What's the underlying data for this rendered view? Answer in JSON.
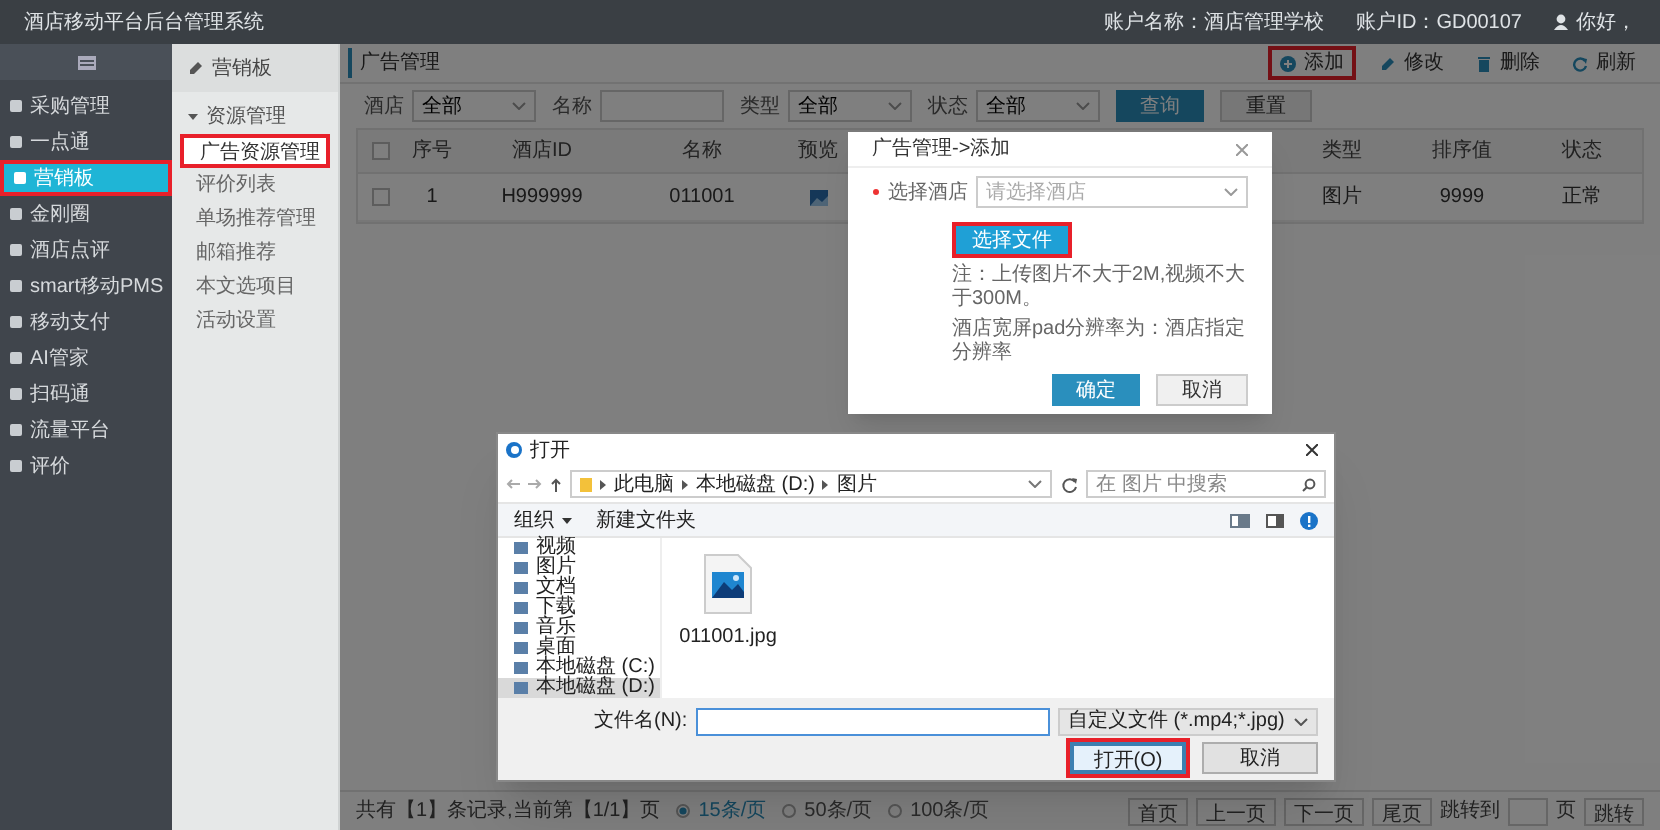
{
  "app": {
    "title": "酒店移动平台后台管理系统",
    "account_name": "账户名称：酒店管理学校",
    "account_id": "账户ID：GD00107",
    "user": "你好，"
  },
  "nav": [
    {
      "label": "采购管理",
      "selected": false,
      "highlighted": false
    },
    {
      "label": "一点通",
      "selected": false,
      "highlighted": false
    },
    {
      "label": "营销板",
      "selected": true,
      "highlighted": true
    },
    {
      "label": "金刚圈",
      "selected": false,
      "highlighted": false
    },
    {
      "label": "酒店点评",
      "selected": false,
      "highlighted": false
    },
    {
      "label": "smart移动PMS",
      "selected": false,
      "highlighted": false
    },
    {
      "label": "移动支付",
      "selected": false,
      "highlighted": false
    },
    {
      "label": "AI管家",
      "selected": false,
      "highlighted": false
    },
    {
      "label": "扫码通",
      "selected": false,
      "highlighted": false
    },
    {
      "label": "流量平台",
      "selected": false,
      "highlighted": false
    },
    {
      "label": "评价",
      "selected": false,
      "highlighted": false
    }
  ],
  "subnav": {
    "title": "营销板",
    "groups": [
      {
        "label": "资源管理",
        "expanded": true,
        "children": [
          {
            "label": "广告资源管理",
            "selected": true,
            "highlighted": true
          },
          {
            "label": "评价列表",
            "selected": false,
            "highlighted": false
          },
          {
            "label": "单场推荐管理",
            "selected": false,
            "highlighted": false
          },
          {
            "label": "邮箱推荐",
            "selected": false,
            "highlighted": false
          },
          {
            "label": "本文选项目",
            "selected": false,
            "highlighted": false
          },
          {
            "label": "活动设置",
            "selected": false,
            "highlighted": false
          }
        ]
      }
    ]
  },
  "page": {
    "breadcrumb": "广告管理",
    "toolbar": [
      {
        "label": "添加",
        "kind": "add",
        "highlighted": true
      },
      {
        "label": "修改",
        "kind": "edit",
        "highlighted": false
      },
      {
        "label": "删除",
        "kind": "delete",
        "highlighted": false
      },
      {
        "label": "刷新",
        "kind": "refresh",
        "highlighted": false
      }
    ],
    "filters": [
      {
        "label": "酒店",
        "kind": "select",
        "value": "全部"
      },
      {
        "label": "名称",
        "kind": "text"
      },
      {
        "label": "类型",
        "kind": "select",
        "value": "全部"
      },
      {
        "label": "状态",
        "kind": "select",
        "value": "全部"
      }
    ],
    "actions": [
      {
        "label": "查询",
        "kind": "primary"
      },
      {
        "label": "重置",
        "kind": "default"
      }
    ],
    "table": {
      "header_checked": false,
      "columns": [
        "序号",
        "酒店ID",
        "名称",
        "预览",
        "类型",
        "排序值",
        "状态"
      ],
      "rows": [
        {
          "checked": false,
          "number": "1",
          "hotel_id": "H999999",
          "name": "011001",
          "preview": {
            "kind": "image"
          },
          "type": "图片",
          "sort": "9999",
          "status": "正常"
        }
      ]
    },
    "pagination": {
      "summary": "共有【1】条记录,当前第【1/1】页",
      "sizes": [
        {
          "label": "15条/页",
          "selected": true
        },
        {
          "label": "50条/页",
          "selected": false
        },
        {
          "label": "100条/页",
          "selected": false
        }
      ],
      "buttons": [
        "首页",
        "上一页",
        "下一页",
        "尾页"
      ],
      "jump_label": "跳转到",
      "page_unit": "页",
      "jump_button": "跳转"
    }
  },
  "modal": {
    "title": "广告管理->添加",
    "field": {
      "label": "选择酒店",
      "required": true,
      "placeholder": "请选择酒店"
    },
    "upload_button": {
      "label": "选择文件",
      "highlighted": true
    },
    "notes": [
      "注：上传图片不大于2M,视频不大于300M。",
      "酒店宽屏pad分辨率为：酒店指定分辨率"
    ],
    "buttons": [
      {
        "label": "确定",
        "kind": "primary"
      },
      {
        "label": "取消",
        "kind": "default"
      }
    ]
  },
  "file_dialog": {
    "title": "打开",
    "path": [
      "此电脑",
      "本地磁盘 (D:)",
      "图片"
    ],
    "search_placeholder": "在 图片 中搜索",
    "toolbar": [
      {
        "label": "组织",
        "menu": true
      },
      {
        "label": "新建文件夹",
        "menu": false
      }
    ],
    "tree": [
      {
        "label": "视频",
        "selected": false
      },
      {
        "label": "图片",
        "selected": false
      },
      {
        "label": "文档",
        "selected": false
      },
      {
        "label": "下载",
        "selected": false
      },
      {
        "label": "音乐",
        "selected": false
      },
      {
        "label": "桌面",
        "selected": false
      },
      {
        "label": "本地磁盘 (C:)",
        "selected": false
      },
      {
        "label": "本地磁盘 (D:)",
        "selected": true
      }
    ],
    "files": [
      {
        "name": "011001.jpg",
        "kind": "image"
      }
    ],
    "filename_label": "文件名(N):",
    "filter": "自定义文件 (*.mp4;*.jpg)",
    "buttons": [
      {
        "label": "打开(O)",
        "kind": "primary",
        "highlighted": true
      },
      {
        "label": "取消",
        "kind": "default",
        "highlighted": false
      }
    ]
  }
}
